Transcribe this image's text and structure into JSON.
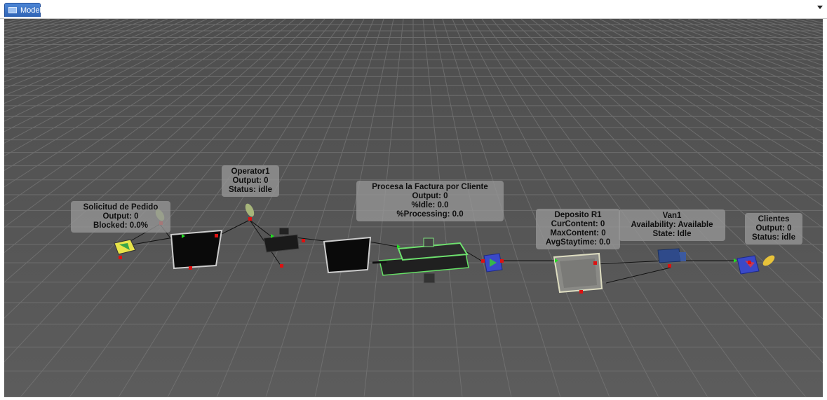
{
  "tab": {
    "label": "Model"
  },
  "objects": {
    "source": {
      "name": "Solicitud de Pedido",
      "output": "Output: 0",
      "blocked": "Blocked: 0.0%"
    },
    "operator": {
      "name": "Operator1",
      "output": "Output: 0",
      "status": "Status: idle"
    },
    "processor": {
      "name": "Procesa la Factura por Cliente",
      "output": "Output: 0",
      "idle": "%Idle:  0.0",
      "processing": "%Processing: 0.0"
    },
    "deposito": {
      "name": "Deposito R1",
      "cur": "CurContent:  0",
      "max": "MaxContent:  0",
      "avg": "AvgStaytime: 0.0"
    },
    "van": {
      "name": "Van1",
      "availability": "Availability:  Available",
      "state": "State:  Idle"
    },
    "clientes": {
      "name": "Clientes",
      "output": "Output: 0",
      "status": "Status: idle"
    }
  },
  "colors": {
    "viewport": "#5a5a5a",
    "grid": "#7a7a7a",
    "tab": "#2f63b5",
    "port_in": "#22dd22",
    "port_out": "#dd1111"
  }
}
